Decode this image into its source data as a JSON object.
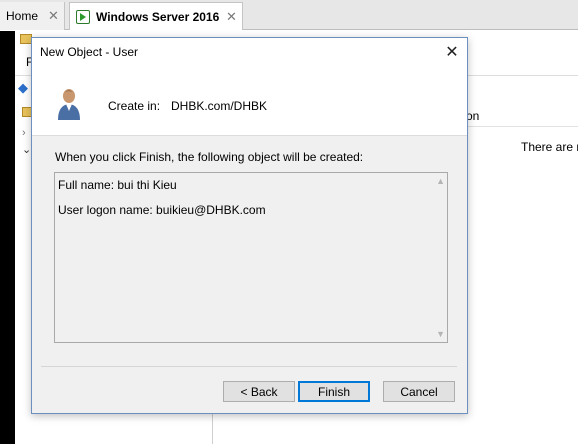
{
  "vm_tabs": [
    {
      "label": "Home",
      "close": "✕"
    },
    {
      "label": "Windows Server 2016",
      "close": "✕"
    }
  ],
  "background": {
    "menu_initial": "F",
    "column_header_fragment": "on",
    "empty_message_fragment": "There are n"
  },
  "dialog": {
    "title": "New Object - User",
    "close_glyph": "✕",
    "create_in_label": "Create in:",
    "create_in_value": "DHBK.com/DHBK",
    "info_text": "When you click Finish, the following object will be created:",
    "summary": {
      "full_name": "Full name: bui thi Kieu",
      "logon_name": "User logon name: buikieu@DHBK.com"
    },
    "buttons": {
      "back": "< Back",
      "finish": "Finish",
      "cancel": "Cancel"
    }
  },
  "icons": {
    "user": "user-icon",
    "vm": "vm-running-icon"
  },
  "colors": {
    "accent": "#0078d7",
    "dialog_bg": "#f0f0f0"
  }
}
